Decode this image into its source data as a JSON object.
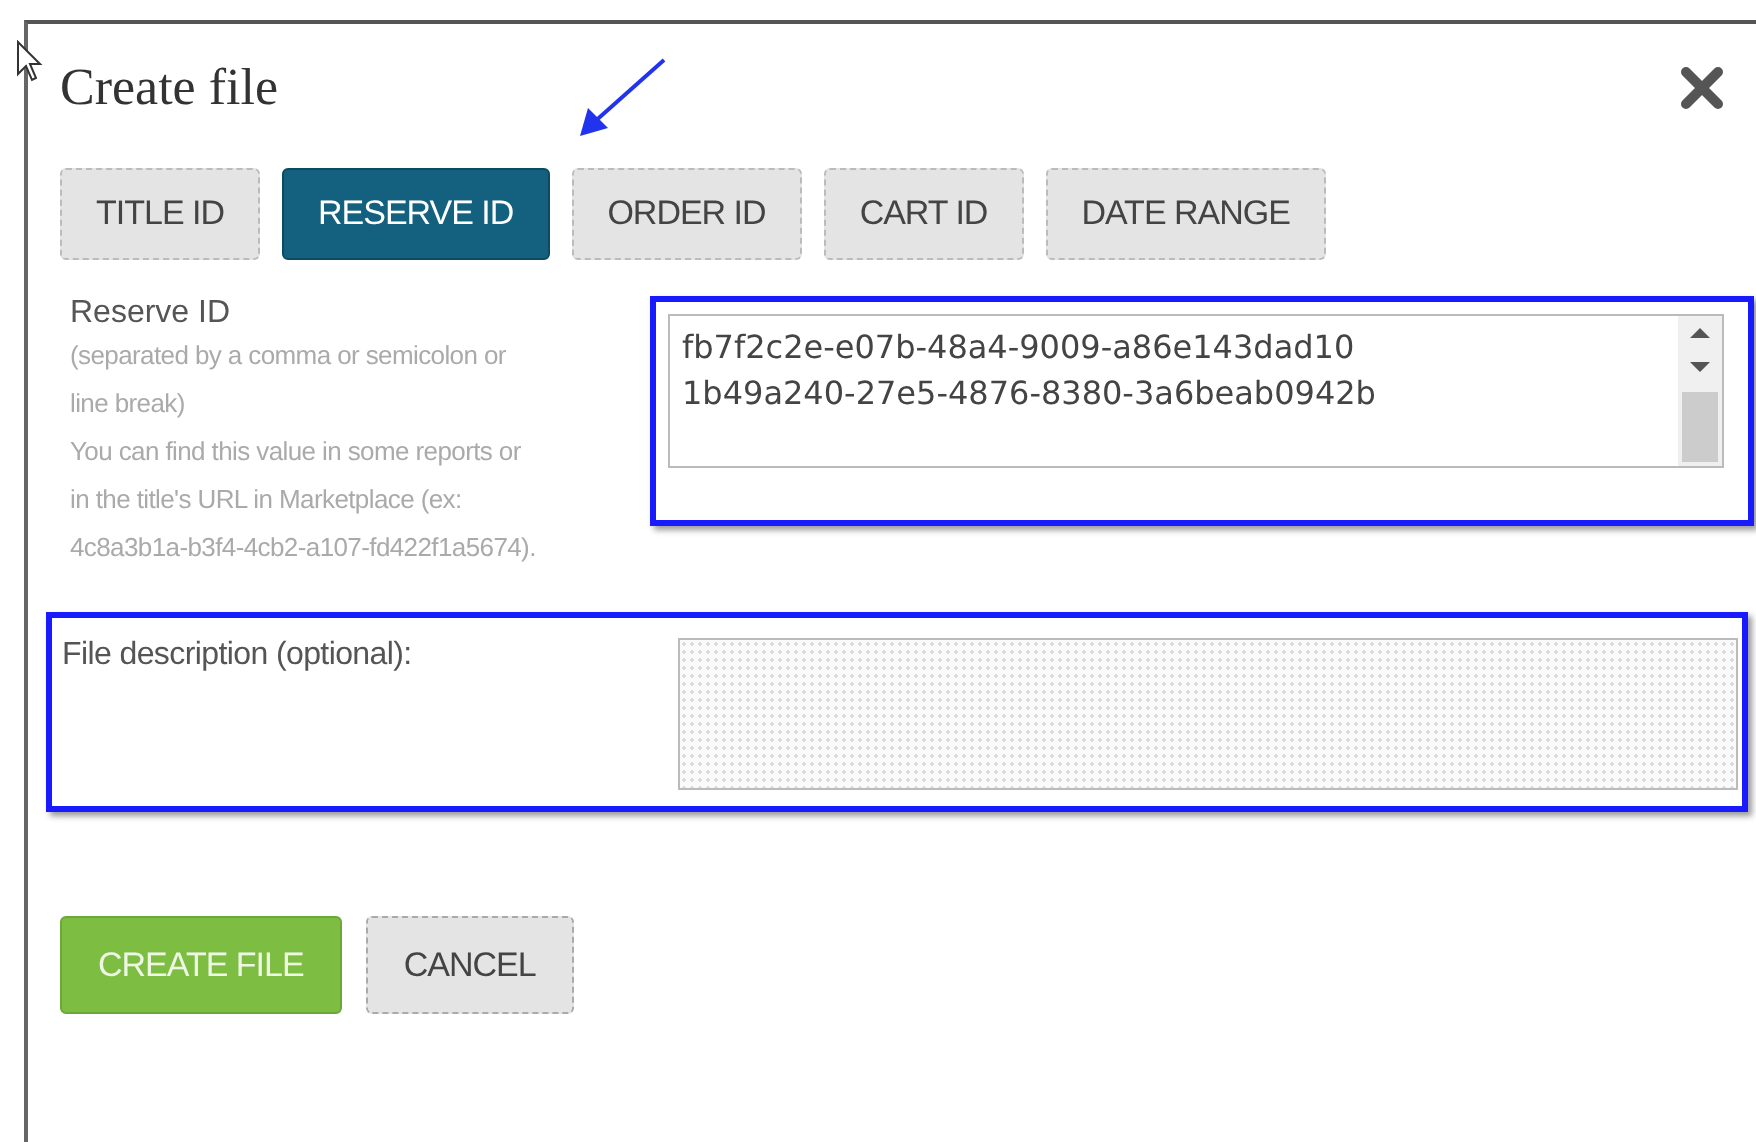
{
  "dialog": {
    "title": "Create file"
  },
  "tabs": [
    {
      "label": "TITLE ID",
      "selected": false
    },
    {
      "label": "RESERVE ID",
      "selected": true
    },
    {
      "label": "ORDER ID",
      "selected": false
    },
    {
      "label": "CART ID",
      "selected": false
    },
    {
      "label": "DATE RANGE",
      "selected": false
    }
  ],
  "reserve_field": {
    "label": "Reserve ID",
    "hints": [
      "(separated by a comma or semicolon or line break)",
      "You can find this value in some reports or in the title's URL in Marketplace (ex: 4c8a3b1a-b3f4-4cb2-a107-fd422f1a5674)."
    ],
    "value": "fb7f2c2e-e07b-48a4-9009-a86e143dad10\n1b49a240-27e5-4876-8380-3a6beab0942b",
    "highlighted": true
  },
  "description_field": {
    "label": "File description (optional):",
    "highlighted": true
  },
  "buttons": [
    {
      "label": "CREATE FILE",
      "kind": "primary"
    },
    {
      "label": "CANCEL",
      "kind": "secondary"
    }
  ]
}
